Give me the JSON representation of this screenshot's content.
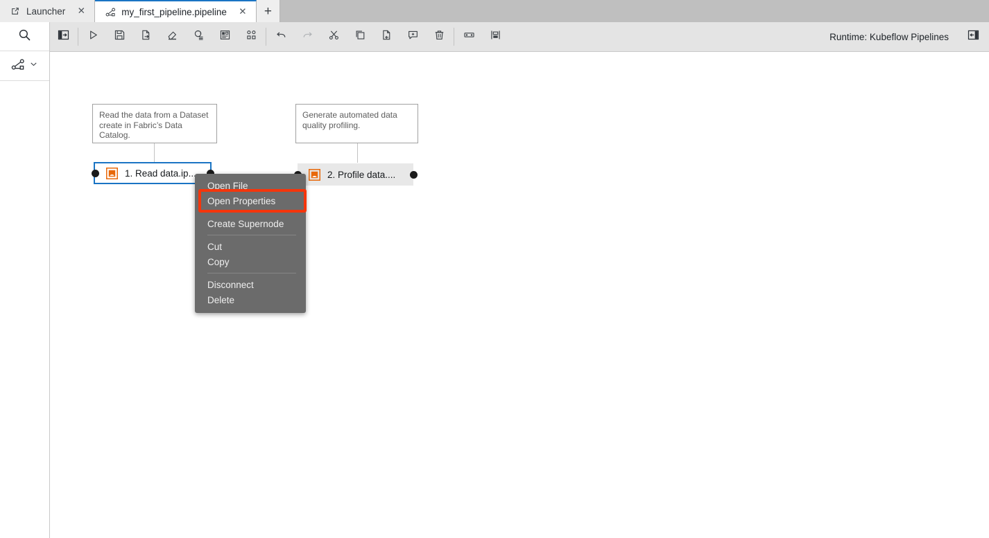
{
  "tabs": [
    {
      "label": "Launcher",
      "icon": "external-link-icon",
      "active": false,
      "close": "✕"
    },
    {
      "label": "my_first_pipeline.pipeline",
      "icon": "pipeline-icon",
      "active": true,
      "close": "✕"
    }
  ],
  "tab_add_label": "+",
  "sidebar": {
    "items": [
      {
        "name": "search",
        "icon": "search-icon"
      },
      {
        "name": "palette",
        "icon": "pipeline-palette-icon",
        "chevron": "chevron-down-icon"
      }
    ]
  },
  "toolbar": {
    "left_panel_toggle": "open-panel-icon",
    "buttons": [
      {
        "name": "run-pipeline",
        "icon": "play-icon",
        "disabled": false
      },
      {
        "name": "save-pipeline",
        "icon": "save-icon",
        "disabled": false
      },
      {
        "name": "export-pipeline",
        "icon": "export-icon",
        "disabled": false
      },
      {
        "name": "clear-pipeline",
        "icon": "eraser-icon",
        "disabled": false
      },
      {
        "name": "open-runtimes",
        "icon": "runtimes-icon",
        "disabled": false
      },
      {
        "name": "open-runtime-images",
        "icon": "runtime-images-icon",
        "disabled": false
      },
      {
        "name": "open-component-catalogs",
        "icon": "component-catalog-icon",
        "disabled": false
      },
      {
        "name": "undo",
        "icon": "undo-icon",
        "disabled": false
      },
      {
        "name": "redo",
        "icon": "redo-icon",
        "disabled": true
      },
      {
        "name": "cut",
        "icon": "scissors-icon",
        "disabled": false
      },
      {
        "name": "copy",
        "icon": "copy-icon",
        "disabled": false
      },
      {
        "name": "paste",
        "icon": "paste-icon",
        "disabled": false
      },
      {
        "name": "add-comment",
        "icon": "comment-plus-icon",
        "disabled": false
      },
      {
        "name": "delete",
        "icon": "trash-icon",
        "disabled": false
      },
      {
        "name": "arrange-horizontally",
        "icon": "arrange-horizontal-icon",
        "disabled": false
      },
      {
        "name": "arrange-vertically",
        "icon": "arrange-vertical-icon",
        "disabled": false
      }
    ],
    "runtime_label": "Runtime: Kubeflow Pipelines",
    "right_panel_toggle": "close-panel-icon"
  },
  "canvas": {
    "comments": [
      {
        "text": "Read the data from a Dataset create in Fabric’s Data Catalog."
      },
      {
        "text": "Generate automated data quality profiling."
      }
    ],
    "nodes": [
      {
        "label": "1. Read data.ip...",
        "icon": "notebook-icon",
        "selected": true
      },
      {
        "label": "2. Profile data....",
        "icon": "notebook-icon",
        "selected": false
      }
    ]
  },
  "context_menu": {
    "items": [
      {
        "label": "Open File",
        "sep_after": false,
        "highlighted": false
      },
      {
        "label": "Open Properties",
        "sep_after": true,
        "highlighted": true
      },
      {
        "label": "Create Supernode",
        "sep_after": true,
        "highlighted": false
      },
      {
        "label": "Cut",
        "sep_after": false,
        "highlighted": false
      },
      {
        "label": "Copy",
        "sep_after": true,
        "highlighted": false
      },
      {
        "label": "Disconnect",
        "sep_after": false,
        "highlighted": false
      },
      {
        "label": "Delete",
        "sep_after": false,
        "highlighted": false
      }
    ]
  },
  "colors": {
    "accent_blue": "#1a74c4",
    "highlight_red": "#f5350b",
    "node_orange": "#e8690b",
    "tabbar_bg": "#bfbfbf",
    "toolbar_bg": "#e4e4e4",
    "menu_bg": "#6b6b6b"
  }
}
